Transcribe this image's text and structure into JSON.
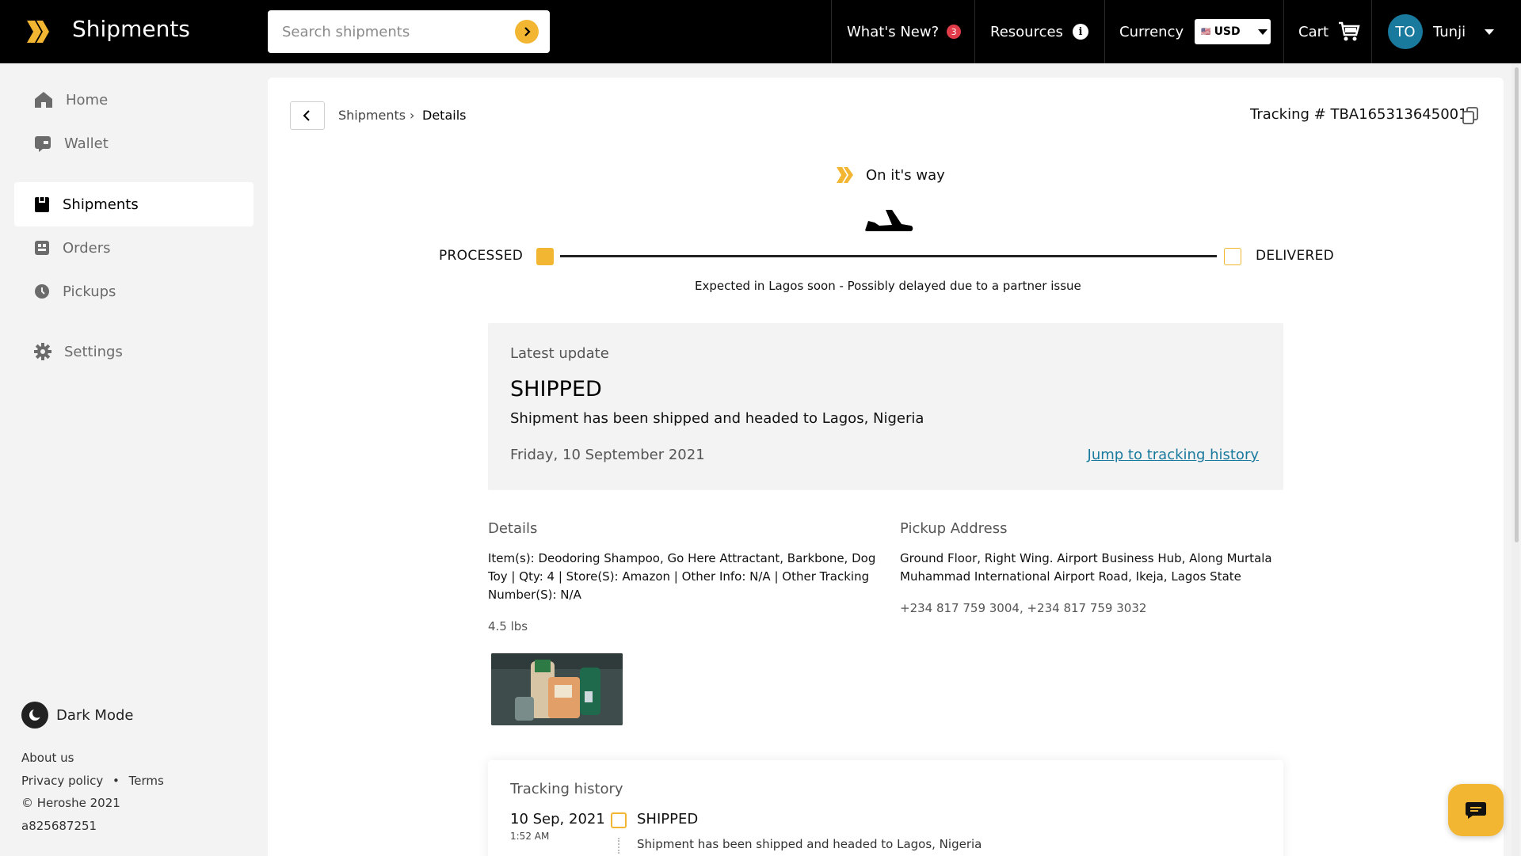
{
  "app": {
    "title": "Shipments"
  },
  "search": {
    "placeholder": "Search shipments"
  },
  "topnav": {
    "whats_new": "What's New?",
    "whats_new_count": "3",
    "resources": "Resources",
    "currency_label": "Currency",
    "currency_value": "USD",
    "cart": "Cart",
    "user_initials": "TO",
    "user_name": "Tunji"
  },
  "sidebar": {
    "items": [
      {
        "label": "Home",
        "icon": "home-icon"
      },
      {
        "label": "Wallet",
        "icon": "wallet-icon"
      },
      {
        "label": "Shipments",
        "icon": "shipments-icon",
        "active": true
      },
      {
        "label": "Orders",
        "icon": "orders-icon"
      },
      {
        "label": "Pickups",
        "icon": "clock-icon"
      },
      {
        "label": "Settings",
        "icon": "gear-icon"
      }
    ],
    "dark_mode": "Dark Mode",
    "footer": {
      "about": "About us",
      "privacy": "Privacy policy",
      "sep": "•",
      "terms": "Terms",
      "copyright": "© Heroshe 2021",
      "build": "a825687251"
    }
  },
  "breadcrumb": {
    "parent": "Shipments",
    "sep": "›",
    "current": "Details"
  },
  "tracking": {
    "label": "Tracking # TBA165313645001"
  },
  "status": {
    "headline": "On it's way",
    "start_label": "PROCESSED",
    "end_label": "DELIVERED",
    "expected": "Expected in Lagos soon - Possibly delayed due to a partner issue"
  },
  "latest_update": {
    "label": "Latest update",
    "status": "SHIPPED",
    "message": "Shipment has been shipped and headed to Lagos, Nigeria",
    "date": "Friday, 10 September 2021",
    "jump_link": "Jump to tracking history"
  },
  "details": {
    "title": "Details",
    "items_text": "Item(s): Deodoring Shampoo, Go Here Attractant, Barkbone, Dog Toy | Qty: 4 | Store(S): Amazon | Other Info: N/A | Other Tracking Number(S): N/A",
    "weight": "4.5 lbs"
  },
  "pickup": {
    "title": "Pickup Address",
    "address": "Ground Floor, Right Wing. Airport Business Hub, Along Murtala Muhammad International Airport Road, Ikeja, Lagos State",
    "phones": "+234 817 759 3004, +234 817 759 3032"
  },
  "history": {
    "title": "Tracking history",
    "entries": [
      {
        "date": "10 Sep, 2021",
        "time": "1:52 AM",
        "status": "SHIPPED",
        "message": "Shipment has been shipped and headed to Lagos, Nigeria"
      }
    ]
  },
  "colors": {
    "accent": "#f2b632",
    "link": "#1a7a9e",
    "topbar": "#000000",
    "badge": "#e23b4a"
  }
}
